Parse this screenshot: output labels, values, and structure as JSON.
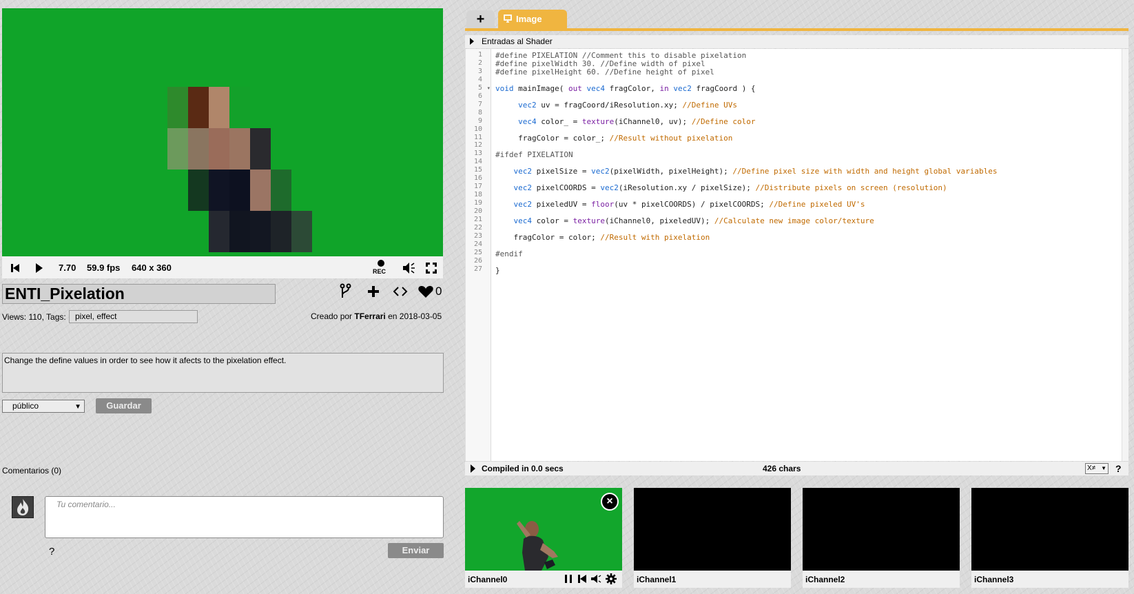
{
  "player": {
    "time": "7.70",
    "fps": "59.9 fps",
    "resolution": "640 x 360",
    "rec_label": "REC"
  },
  "shader": {
    "title": "ENTI_Pixelation",
    "likes": "0",
    "views_label": "Views: 110, Tags:",
    "tags": "pixel, effect",
    "created_prefix": "Creado por",
    "author": "TFerrari",
    "created_date": "en 2018-03-05",
    "description": "Change the define values in order to see how it afects to the pixelation effect.",
    "visibility": "público",
    "save_label": "Guardar"
  },
  "comments": {
    "heading": "Comentarios (0)",
    "placeholder": "Tu comentario...",
    "help": "?",
    "send_label": "Enviar"
  },
  "editor": {
    "tab_add": "+",
    "tab_image": "Image",
    "shader_inputs_label": "Entradas al Shader",
    "compile_status": "Compiled in 0.0 secs",
    "char_count": "426 chars",
    "font_size_option": "X≠",
    "help": "?",
    "line_numbers": [
      "1",
      "2",
      "3",
      "4",
      "5",
      "6",
      "7",
      "8",
      "9",
      "10",
      "11",
      "12",
      "13",
      "14",
      "15",
      "16",
      "17",
      "18",
      "19",
      "20",
      "21",
      "22",
      "23",
      "24",
      "25",
      "26",
      "27"
    ]
  },
  "channels": [
    {
      "label": "iChannel0"
    },
    {
      "label": "iChannel1"
    },
    {
      "label": "iChannel2"
    },
    {
      "label": "iChannel3"
    }
  ],
  "colors": {
    "accent": "#f0b540",
    "canvas_green": "#10a429",
    "button_gray": "#8a8a8a"
  }
}
